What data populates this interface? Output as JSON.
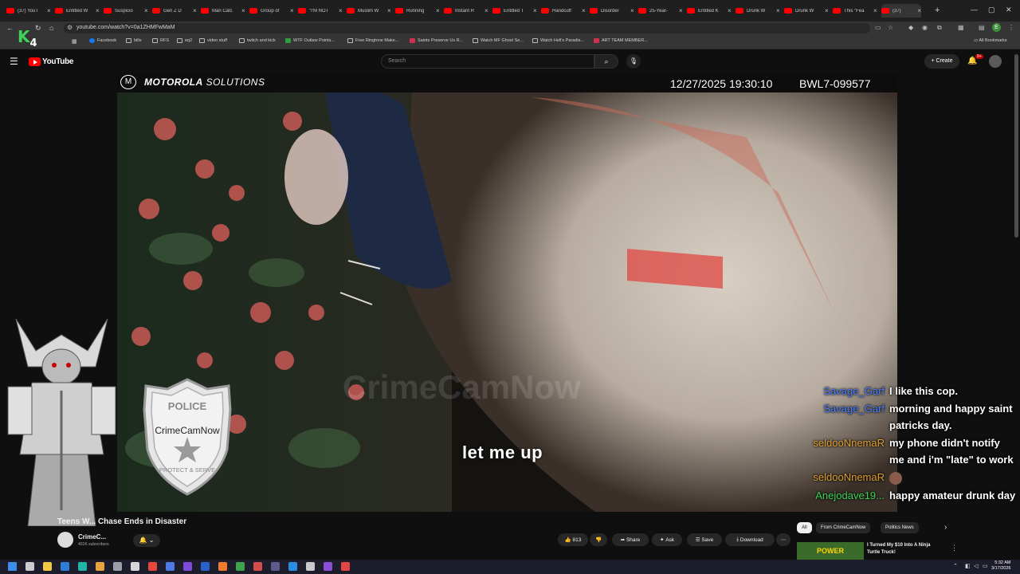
{
  "browser": {
    "tabs": [
      {
        "title": "(37) YouT"
      },
      {
        "title": "Entitled W"
      },
      {
        "title": "Suspicio"
      },
      {
        "title": "Gen Z D"
      },
      {
        "title": "Man Catc"
      },
      {
        "title": "Group of"
      },
      {
        "title": "\"I'M NOT"
      },
      {
        "title": "Muslim W"
      },
      {
        "title": "Running"
      },
      {
        "title": "Instant R"
      },
      {
        "title": "Entitled T"
      },
      {
        "title": "Handcuff"
      },
      {
        "title": "Disorder"
      },
      {
        "title": "25-Year-"
      },
      {
        "title": "Entitled K"
      },
      {
        "title": "Drunk W"
      },
      {
        "title": "Drunk W"
      },
      {
        "title": "This \"Fea"
      },
      {
        "title": "(37)"
      }
    ],
    "new_tab": "+",
    "window_controls": {
      "minimize": "—",
      "maximize": "▢",
      "close": "✕"
    },
    "url": "youtube.com/watch?v=0a1ZHMFwMaM",
    "bookmarks": [
      {
        "label": "Facebook",
        "icon": "facebook-icon"
      },
      {
        "label": "bills",
        "icon": "folder-icon"
      },
      {
        "label": "RFS",
        "icon": "folder-icon"
      },
      {
        "label": "eq2",
        "icon": "folder-icon"
      },
      {
        "label": "video stuff",
        "icon": "folder-icon"
      },
      {
        "label": "twitch and kick",
        "icon": "folder-icon"
      },
      {
        "label": "WTF Outlaw Points...",
        "icon": "green-site-icon"
      },
      {
        "label": "Free Ringtone Make...",
        "icon": "site-icon"
      },
      {
        "label": "Saints Preserve Us R...",
        "icon": "red-site-icon"
      },
      {
        "label": "Watch MF Ghost Se...",
        "icon": "site-icon"
      },
      {
        "label": "Watch Hell's Paradis...",
        "icon": "site-icon"
      },
      {
        "label": "ART TEAM MEMBER...",
        "icon": "red-site-icon"
      }
    ],
    "all_bookmarks": "All Bookmarks",
    "profile_initial": "E"
  },
  "streamer_logo": {
    "letter": "K",
    "number": "4"
  },
  "youtube": {
    "logo_text": "YouTube",
    "search_placeholder": "Search",
    "create_label": "Create",
    "notif_badge": "9+"
  },
  "video": {
    "brand_bold": "MOTOROLA",
    "brand_light": " SOLUTIONS",
    "timestamp": "12/27/2025 19:30:10",
    "device_id": "BWL7-099577",
    "caption": "let me up",
    "watermark": "CrimeCamNow"
  },
  "overlay_badge": {
    "top": "POLICE",
    "name": "CrimeCamNow",
    "bottom": "PROTECT & SERVE"
  },
  "chat": [
    {
      "user": "Savage_Garf",
      "user_color": "#4a7dff",
      "message": "I like this cop."
    },
    {
      "user": "Savage_Garf",
      "user_color": "#4a7dff",
      "message": "morning and happy saint"
    },
    {
      "user": "",
      "user_color": "#4a7dff",
      "message": "patricks day."
    },
    {
      "user": "seldooNnemaR",
      "user_color": "#e0a030",
      "message": "my phone didn't notify"
    },
    {
      "user": "",
      "user_color": "#e0a030",
      "message": "me and i'm \"late\" to work"
    },
    {
      "user": "seldooNnemaR",
      "user_color": "#e0a030",
      "message": ""
    },
    {
      "user": "Anejodave19...",
      "user_color": "#3fd35a",
      "message": "happy amateur drunk day"
    }
  ],
  "video_info": {
    "title": "Teens W... Chase Ends in Disaster",
    "channel": "CrimeC...",
    "subscribers": "401K subscribers",
    "likes": "813",
    "share": "Share",
    "ask": "Ask",
    "save": "Save",
    "download": "Download"
  },
  "chips": [
    "All",
    "From CrimeCamNow",
    "Politics News"
  ],
  "recommended": {
    "title": "I Turned My $10 Into A Ninja Turtle Truck!",
    "thumb_text": "POWER"
  },
  "taskbar": {
    "time": "5:32 AM",
    "date": "3/17/2026"
  },
  "colors": {
    "accent": "#ff0000",
    "background": "#0f0f0f"
  }
}
